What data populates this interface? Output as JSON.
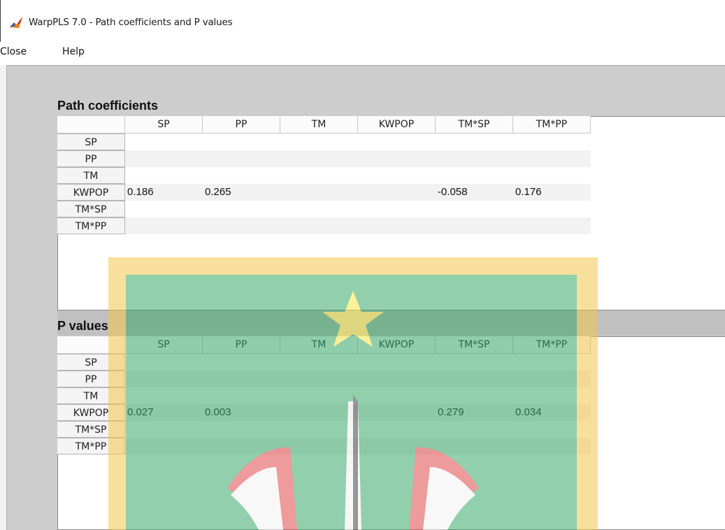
{
  "window": {
    "title": "WarpPLS 7.0 - Path coefficients and P values"
  },
  "menu": {
    "items": [
      "Close",
      "Help"
    ]
  },
  "colors": {
    "workarea": "#cdcdcd",
    "row_alt": "#f2f2f2",
    "grid_line": "#c8c8c8"
  },
  "path_coefficients": {
    "title": "Path coefficients",
    "columns": [
      "SP",
      "PP",
      "TM",
      "KWPOP",
      "TM*SP",
      "TM*PP"
    ],
    "rows": [
      {
        "label": "SP",
        "values": [
          "",
          "",
          "",
          "",
          "",
          ""
        ]
      },
      {
        "label": "PP",
        "values": [
          "",
          "",
          "",
          "",
          "",
          ""
        ]
      },
      {
        "label": "TM",
        "values": [
          "",
          "",
          "",
          "",
          "",
          ""
        ]
      },
      {
        "label": "KWPOP",
        "values": [
          "0.186",
          "0.265",
          "",
          "",
          "-0.058",
          "0.176"
        ]
      },
      {
        "label": "TM*SP",
        "values": [
          "",
          "",
          "",
          "",
          "",
          ""
        ]
      },
      {
        "label": "TM*PP",
        "values": [
          "",
          "",
          "",
          "",
          "",
          ""
        ]
      }
    ]
  },
  "p_values": {
    "title": "P values",
    "columns": [
      "SP",
      "PP",
      "TM",
      "KWPOP",
      "TM*SP",
      "TM*PP"
    ],
    "rows": [
      {
        "label": "SP",
        "values": [
          "",
          "",
          "",
          "",
          "",
          ""
        ]
      },
      {
        "label": "PP",
        "values": [
          "",
          "",
          "",
          "",
          "",
          ""
        ]
      },
      {
        "label": "TM",
        "values": [
          "",
          "",
          "",
          "",
          "",
          ""
        ]
      },
      {
        "label": "KWPOP",
        "values": [
          "0.027",
          "0.003",
          "",
          "",
          "0.279",
          "0.034"
        ]
      },
      {
        "label": "TM*SP",
        "values": [
          "",
          "",
          "",
          "",
          "",
          ""
        ]
      },
      {
        "label": "TM*PP",
        "values": [
          "",
          "",
          "",
          "",
          "",
          ""
        ]
      }
    ]
  }
}
